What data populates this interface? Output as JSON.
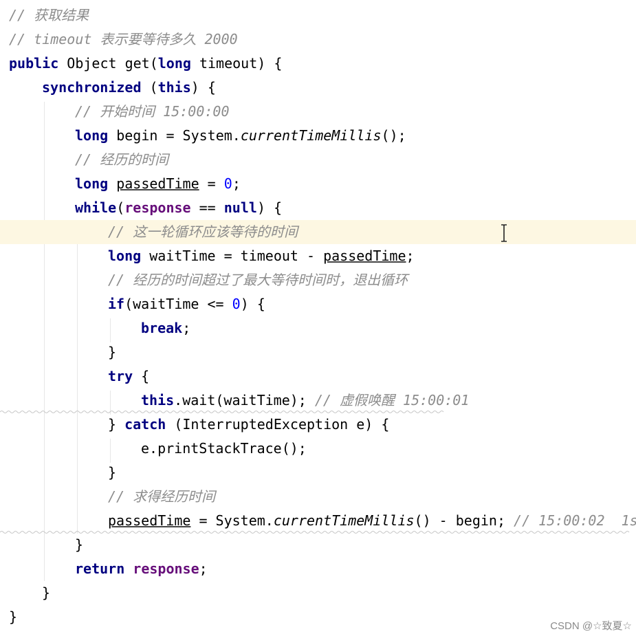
{
  "watermark": "CSDN @☆致夏☆",
  "colors": {
    "keyword": "#000080",
    "comment": "#8c8c8c",
    "field": "#660e7a",
    "number": "#0000ff",
    "caret_line": "#fdf7e2"
  },
  "cursor_icon": "text-cursor-icon",
  "lines": [
    {
      "indent": 0,
      "caret": false,
      "tokens": [
        {
          "t": "cm",
          "v": "// 获取结果"
        }
      ]
    },
    {
      "indent": 0,
      "caret": false,
      "tokens": [
        {
          "t": "cm",
          "v": "// timeout 表示要等待多久 2000"
        }
      ]
    },
    {
      "indent": 0,
      "caret": false,
      "tokens": [
        {
          "t": "kw",
          "v": "public "
        },
        {
          "t": "pl",
          "v": "Object get("
        },
        {
          "t": "kw",
          "v": "long "
        },
        {
          "t": "pl",
          "v": "timeout) {"
        }
      ]
    },
    {
      "indent": 1,
      "caret": false,
      "tokens": [
        {
          "t": "kw",
          "v": "synchronized "
        },
        {
          "t": "pl",
          "v": "("
        },
        {
          "t": "kw",
          "v": "this"
        },
        {
          "t": "pl",
          "v": ") {"
        }
      ]
    },
    {
      "indent": 2,
      "caret": false,
      "tokens": [
        {
          "t": "cm",
          "v": "// 开始时间 15:00:00"
        }
      ]
    },
    {
      "indent": 2,
      "caret": false,
      "tokens": [
        {
          "t": "kw",
          "v": "long "
        },
        {
          "t": "pl",
          "v": "begin = System."
        },
        {
          "t": "st",
          "v": "currentTimeMillis"
        },
        {
          "t": "pl",
          "v": "();"
        }
      ]
    },
    {
      "indent": 2,
      "caret": false,
      "tokens": [
        {
          "t": "cm",
          "v": "// 经历的时间"
        }
      ]
    },
    {
      "indent": 2,
      "caret": false,
      "tokens": [
        {
          "t": "kw",
          "v": "long "
        },
        {
          "t": "ul",
          "v": "passedTime"
        },
        {
          "t": "pl",
          "v": " = "
        },
        {
          "t": "num",
          "v": "0"
        },
        {
          "t": "pl",
          "v": ";"
        }
      ]
    },
    {
      "indent": 2,
      "caret": false,
      "tokens": [
        {
          "t": "kw",
          "v": "while"
        },
        {
          "t": "pl",
          "v": "("
        },
        {
          "t": "fld",
          "v": "response"
        },
        {
          "t": "pl",
          "v": " == "
        },
        {
          "t": "kw",
          "v": "null"
        },
        {
          "t": "pl",
          "v": ") {"
        }
      ]
    },
    {
      "indent": 3,
      "caret": true,
      "tokens": [
        {
          "t": "cm",
          "v": "// 这一轮循环应该等待的时间"
        }
      ]
    },
    {
      "indent": 3,
      "caret": false,
      "tokens": [
        {
          "t": "kw",
          "v": "long "
        },
        {
          "t": "pl",
          "v": "waitTime = timeout - "
        },
        {
          "t": "ul",
          "v": "passedTime"
        },
        {
          "t": "pl",
          "v": ";"
        }
      ]
    },
    {
      "indent": 3,
      "caret": false,
      "tokens": [
        {
          "t": "cm",
          "v": "// 经历的时间超过了最大等待时间时，退出循环"
        }
      ]
    },
    {
      "indent": 3,
      "caret": false,
      "tokens": [
        {
          "t": "kw",
          "v": "if"
        },
        {
          "t": "pl",
          "v": "(waitTime <= "
        },
        {
          "t": "num",
          "v": "0"
        },
        {
          "t": "pl",
          "v": ") {"
        }
      ]
    },
    {
      "indent": 4,
      "caret": false,
      "tokens": [
        {
          "t": "kw",
          "v": "break"
        },
        {
          "t": "pl",
          "v": ";"
        }
      ]
    },
    {
      "indent": 3,
      "caret": false,
      "tokens": [
        {
          "t": "pl",
          "v": "}"
        }
      ]
    },
    {
      "indent": 3,
      "caret": false,
      "tokens": [
        {
          "t": "kw",
          "v": "try "
        },
        {
          "t": "pl",
          "v": "{"
        }
      ]
    },
    {
      "indent": 4,
      "caret": false,
      "tokens": [
        {
          "t": "kw",
          "v": "this"
        },
        {
          "t": "pl",
          "v": ".wait(waitTime); "
        },
        {
          "t": "cm",
          "v": "// 虚假唤醒 15:00:01"
        }
      ]
    },
    {
      "indent": 3,
      "caret": false,
      "tokens": [
        {
          "t": "pl",
          "v": "} "
        },
        {
          "t": "kw",
          "v": "catch "
        },
        {
          "t": "pl",
          "v": "(InterruptedException e) {"
        }
      ]
    },
    {
      "indent": 4,
      "caret": false,
      "tokens": [
        {
          "t": "pl",
          "v": "e.printStackTrace();"
        }
      ]
    },
    {
      "indent": 3,
      "caret": false,
      "tokens": [
        {
          "t": "pl",
          "v": "}"
        }
      ]
    },
    {
      "indent": 3,
      "caret": false,
      "tokens": [
        {
          "t": "cm",
          "v": "// 求得经历时间"
        }
      ]
    },
    {
      "indent": 3,
      "caret": false,
      "tokens": [
        {
          "t": "ul",
          "v": "passedTime"
        },
        {
          "t": "pl",
          "v": " = System."
        },
        {
          "t": "st",
          "v": "currentTimeMillis"
        },
        {
          "t": "pl",
          "v": "() - begin; "
        },
        {
          "t": "cm",
          "v": "// 15:00:02  1s"
        }
      ]
    },
    {
      "indent": 2,
      "caret": false,
      "tokens": [
        {
          "t": "pl",
          "v": "}"
        }
      ]
    },
    {
      "indent": 2,
      "caret": false,
      "tokens": [
        {
          "t": "kw",
          "v": "return "
        },
        {
          "t": "fld",
          "v": "response"
        },
        {
          "t": "pl",
          "v": ";"
        }
      ]
    },
    {
      "indent": 1,
      "caret": false,
      "tokens": [
        {
          "t": "pl",
          "v": "}"
        }
      ]
    },
    {
      "indent": 0,
      "caret": false,
      "tokens": [
        {
          "t": "pl",
          "v": "}"
        }
      ]
    }
  ]
}
